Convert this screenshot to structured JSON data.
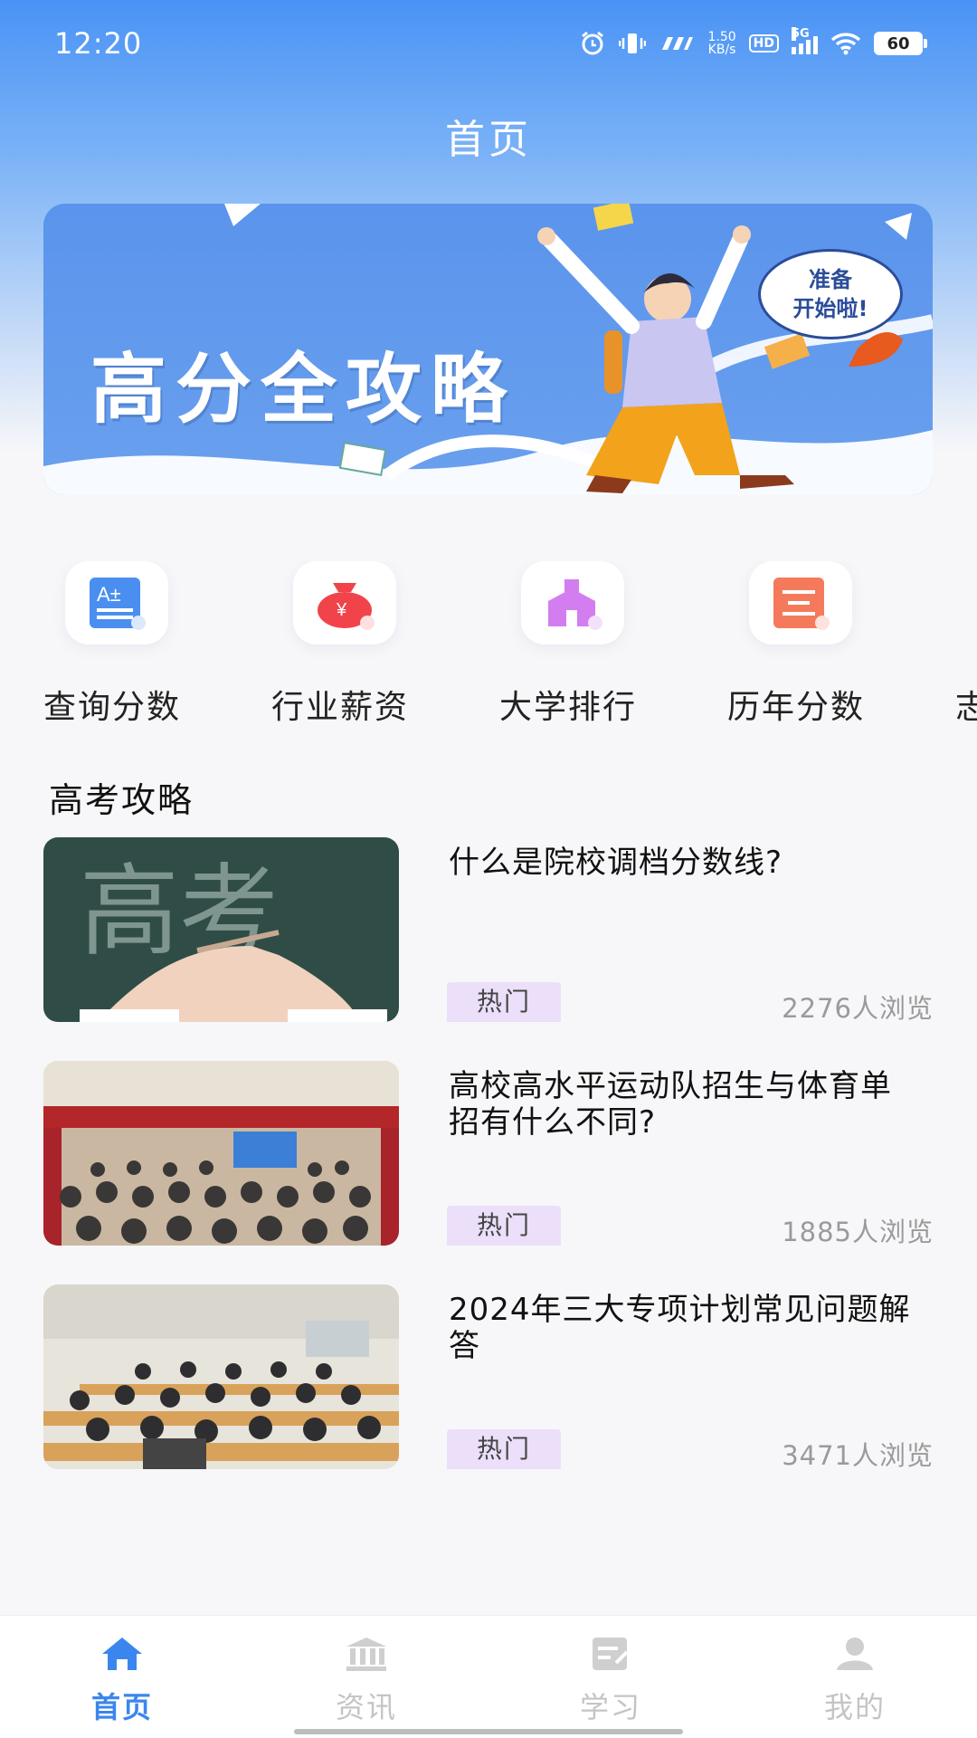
{
  "status_bar": {
    "time": "12:20",
    "net_speed_value": "1.50",
    "net_speed_unit": "KB/s",
    "hd": "HD",
    "network": "5G",
    "battery": "60"
  },
  "header": {
    "title": "首页"
  },
  "banner": {
    "title": "高分全攻略",
    "bubble_line1": "准备",
    "bubble_line2": "开始啦!"
  },
  "quick_menu": {
    "items": [
      {
        "label": "查询分数",
        "icon": "score-query-icon",
        "color": "#4a8ff0"
      },
      {
        "label": "行业薪资",
        "icon": "money-bag-icon",
        "color": "#f0444a"
      },
      {
        "label": "大学排行",
        "icon": "university-icon",
        "color": "#d37ef0"
      },
      {
        "label": "历年分数",
        "icon": "history-scores-icon",
        "color": "#f57a5c"
      },
      {
        "label": "志"
      }
    ]
  },
  "section": {
    "title": "高考攻略"
  },
  "articles": [
    {
      "title": "什么是院校调档分数线?",
      "tag": "热门",
      "views": "2276人浏览"
    },
    {
      "title": "高校高水平运动队招生与体育单招有什么不同?",
      "tag": "热门",
      "views": "1885人浏览"
    },
    {
      "title": "2024年三大专项计划常见问题解答",
      "tag": "热门",
      "views": "3471人浏览"
    }
  ],
  "article_thumbs": {
    "chalkboard_text": "高考"
  },
  "bottom_nav": {
    "items": [
      {
        "label": "首页",
        "icon": "home-icon",
        "active": true
      },
      {
        "label": "资讯",
        "icon": "bank-icon",
        "active": false
      },
      {
        "label": "学习",
        "icon": "notebook-icon",
        "active": false
      },
      {
        "label": "我的",
        "icon": "user-icon",
        "active": false
      }
    ]
  },
  "colors": {
    "accent": "#3b86ee",
    "tag_bg": "#ecdff9",
    "muted": "#9a9a9a"
  }
}
